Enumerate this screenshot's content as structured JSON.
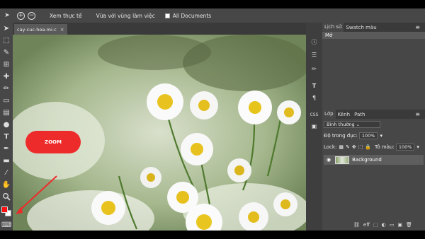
{
  "topbar": {
    "actual_pixels": "Xem thực tế",
    "fit_area": "Vừa với vùng làm việc",
    "all_documents": "All Documents"
  },
  "document": {
    "tab_label": "cay-cuc-hoa-mi-c",
    "close": "×"
  },
  "panels": {
    "history_tab": "Lịch sử",
    "swatches_tab": "Swatch màu",
    "history_item": "Mở",
    "layers_tab": "Lớp",
    "channels_tab": "Kênh",
    "paths_tab": "Path",
    "blend_mode": "Bình thường",
    "opacity_label": "Độ trong đục:",
    "opacity_value": "100%",
    "lock_label": "Lock:",
    "fill_label": "Tô màu:",
    "fill_value": "100%",
    "layer_name": "Background",
    "side_css": "CSS",
    "layer_bottom_icons": [
      "eff",
      "⬚",
      "◐",
      "▭",
      "▣",
      "🗑"
    ]
  },
  "annotation": {
    "label": "ZOOM"
  },
  "colors": {
    "foreground": "#ff1010",
    "background": "#ffffff",
    "accent": "#ee2b2b"
  }
}
